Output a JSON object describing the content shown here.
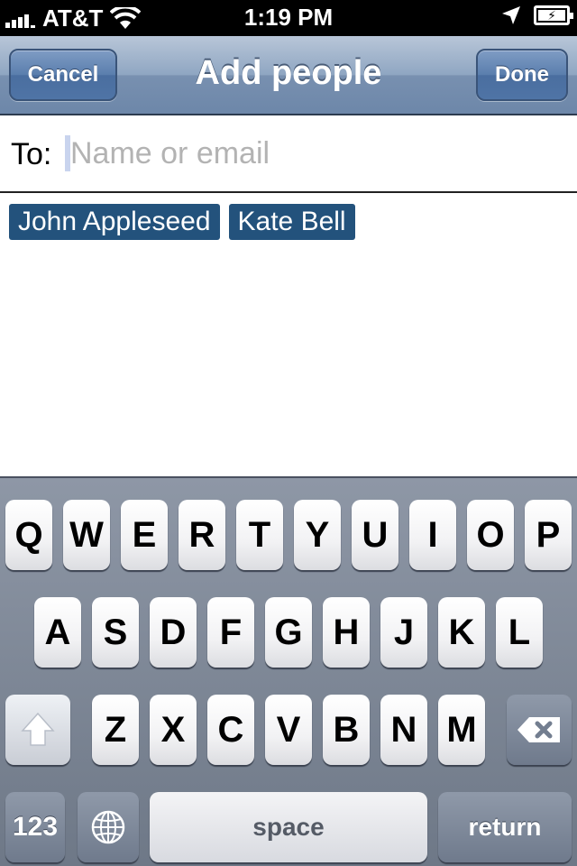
{
  "status_bar": {
    "carrier": "AT&T",
    "time": "1:19 PM",
    "icons": [
      "signal-bars-icon",
      "wifi-icon",
      "location-arrow-icon",
      "battery-charging-icon"
    ]
  },
  "nav": {
    "title": "Add people",
    "cancel_label": "Cancel",
    "done_label": "Done"
  },
  "to_field": {
    "label": "To:",
    "value": "",
    "placeholder": "Name or email"
  },
  "recipients": [
    "John Appleseed",
    "Kate Bell"
  ],
  "keyboard": {
    "row1": [
      "Q",
      "W",
      "E",
      "R",
      "T",
      "Y",
      "U",
      "I",
      "O",
      "P"
    ],
    "row2": [
      "A",
      "S",
      "D",
      "F",
      "G",
      "H",
      "J",
      "K",
      "L"
    ],
    "row3": [
      "Z",
      "X",
      "C",
      "V",
      "B",
      "N",
      "M"
    ],
    "numbers_label": "123",
    "space_label": "space",
    "return_label": "return",
    "icons": [
      "shift-icon",
      "delete-icon",
      "globe-icon"
    ]
  },
  "colors": {
    "chip_background": "#23527c",
    "nav_bar": "#8fa6c2"
  }
}
